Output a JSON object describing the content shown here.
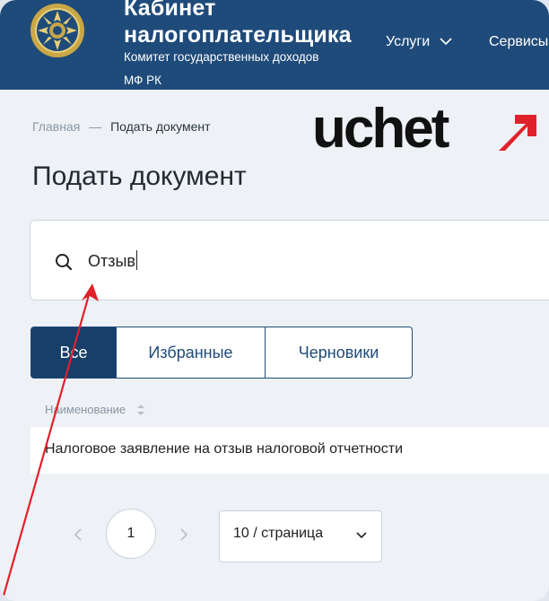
{
  "header": {
    "title": "Кабинет\nналогоплательщика",
    "title_line1": "Кабинет",
    "title_line2": "налогоплательщика",
    "subtitle_line1": "Комитет государственных доходов",
    "subtitle_line2": "МФ РК",
    "nav": [
      {
        "label": "Услуги"
      },
      {
        "label": "Сервисы"
      }
    ]
  },
  "breadcrumb": {
    "home": "Главная",
    "separator": "—",
    "current": "Подать документ"
  },
  "brand_logo": "uchet",
  "page_title": "Подать документ",
  "search": {
    "value": "Отзыв",
    "icon": "search-icon"
  },
  "tabs": [
    {
      "label": "Все",
      "active": true
    },
    {
      "label": "Избранные",
      "active": false
    },
    {
      "label": "Черновики",
      "active": false
    }
  ],
  "table": {
    "column_header": "Наименование",
    "rows": [
      {
        "name": "Налоговое заявление на отзыв налоговой отчетности"
      }
    ]
  },
  "pagination": {
    "current_page": "1",
    "per_page": "10 / страница"
  },
  "colors": {
    "header_bg": "#1f4b7a",
    "active_tab": "#173f69",
    "annotation_arrow": "#e0212b",
    "logo_text": "#111111"
  }
}
